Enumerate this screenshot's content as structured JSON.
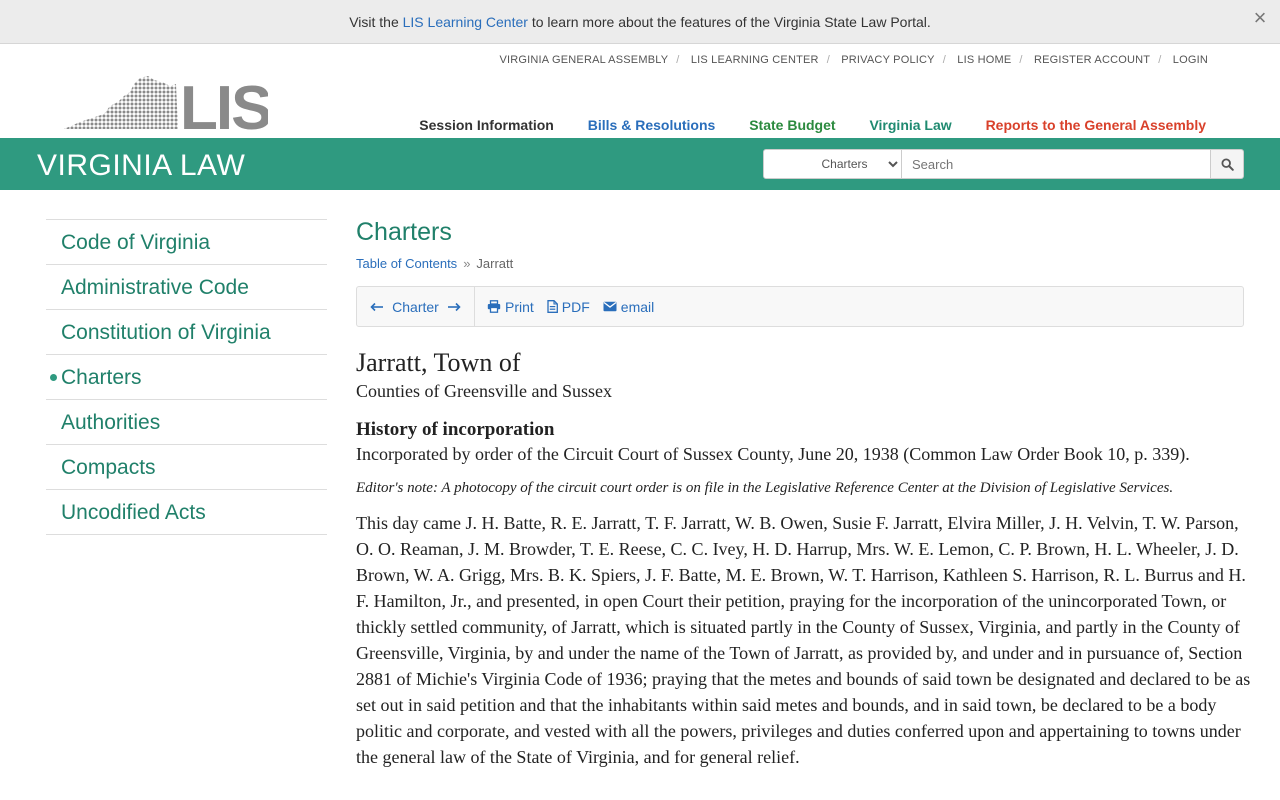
{
  "notice": {
    "prefix": "Visit the ",
    "link": "LIS Learning Center",
    "suffix": " to learn more about the features of the Virginia State Law Portal.",
    "close": "×"
  },
  "utility_links": [
    "VIRGINIA GENERAL ASSEMBLY",
    "LIS LEARNING CENTER",
    "PRIVACY POLICY",
    "LIS HOME",
    "REGISTER ACCOUNT",
    "LOGIN"
  ],
  "logo": {
    "text": "LIS"
  },
  "main_nav": [
    {
      "label": "Session Information",
      "color": "#333333"
    },
    {
      "label": "Bills & Resolutions",
      "color": "#2a6ebb"
    },
    {
      "label": "State Budget",
      "color": "#2b8a3e"
    },
    {
      "label": "Virginia Law",
      "color": "#1f8a70"
    },
    {
      "label": "Reports to the General Assembly",
      "color": "#d9412b"
    }
  ],
  "band": {
    "brand": "VIRGINIA LAW",
    "color": "#2f9a80",
    "search_scope": "Charters",
    "search_placeholder": "Search"
  },
  "sidebar": [
    {
      "label": "Code of Virginia",
      "active": false
    },
    {
      "label": "Administrative Code",
      "active": false
    },
    {
      "label": "Constitution of Virginia",
      "active": false
    },
    {
      "label": "Charters",
      "active": true
    },
    {
      "label": "Authorities",
      "active": false
    },
    {
      "label": "Compacts",
      "active": false
    },
    {
      "label": "Uncodified Acts",
      "active": false
    }
  ],
  "content": {
    "title": "Charters",
    "breadcrumb": {
      "root": "Table of Contents",
      "sep": "»",
      "current": "Jarratt"
    },
    "toolbar": {
      "nav_label": "Charter",
      "print": "Print",
      "pdf": "PDF",
      "email": "email"
    },
    "heading": "Jarratt, Town of",
    "counties": "Counties of Greensville and Sussex",
    "history_heading": "History of incorporation",
    "history_text": "Incorporated by order of the Circuit Court of Sussex County, June 20, 1938 (Common Law Order Book 10, p. 339).",
    "editor_note": "Editor's note: A photocopy of the circuit court order is on file in the Legislative Reference Center at the Division of Legislative Services.",
    "body": "This day came J. H. Batte, R. E. Jarratt, T. F. Jarratt, W. B. Owen, Susie F. Jarratt, Elvira Miller, J. H. Velvin, T. W. Parson, O. O. Reaman, J. M. Browder, T. E. Reese, C. C. Ivey, H. D. Harrup, Mrs. W. E. Lemon, C. P. Brown, H. L. Wheeler, J. D. Brown, W. A. Grigg, Mrs. B. K. Spiers, J. F. Batte, M. E. Brown, W. T. Harrison, Kathleen S. Harrison, R. L. Burrus and H. F. Hamilton, Jr., and presented, in open Court their petition, praying for the incorporation of the unincorporated Town, or thickly settled community, of Jarratt, which is situated partly in the County of Sussex, Virginia, and partly in the County of Greensville, Virginia, by and under the name of the Town of Jarratt, as provided by, and under and in pursuance of, Section 2881 of Michie's Virginia Code of 1936; praying that the metes and bounds of said town be designated and declared to be as set out in said petition and that the inhabitants within said metes and bounds, and in said town, be declared to be a body politic and corporate, and vested with all the powers, privileges and duties conferred upon and appertaining to towns under the general law of the State of Virginia, and for general relief."
  }
}
